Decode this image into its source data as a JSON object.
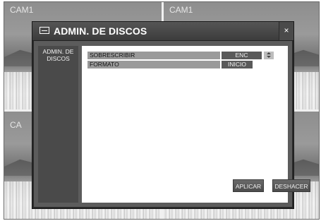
{
  "cameras": {
    "tile1_label": "CAM1",
    "tile2_label": "CAM1",
    "tile3_label": "CA"
  },
  "dialog": {
    "title": "ADMIN. DE DISCOS",
    "close_glyph": "×",
    "header_icon": "disk-icon"
  },
  "sidebar": {
    "items": [
      {
        "label": "ADMIN. DE DISCOS",
        "selected": true
      }
    ]
  },
  "settings": {
    "rows": [
      {
        "label": "SOBRESCRIBIR",
        "value": "ENC"
      },
      {
        "label": "FORMATO",
        "value": "INICIO"
      }
    ]
  },
  "buttons": {
    "apply": "APLICAR",
    "undo": "DESHACER"
  },
  "colors": {
    "dialog_bg": "#5c5c5c",
    "panel_bg": "#ffffff",
    "label_bg": "#9a9a9a",
    "value_bg": "#5a5a5a"
  }
}
